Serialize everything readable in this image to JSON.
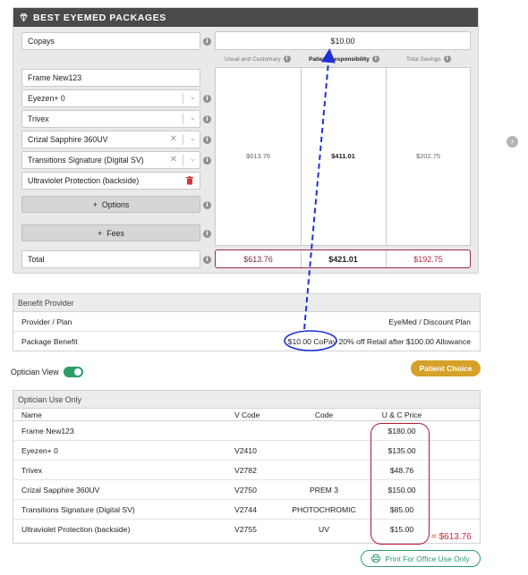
{
  "packages": {
    "title": "BEST EYEMED PACKAGES",
    "copays_label": "Copays",
    "copay_value": "$10.00",
    "columns": [
      "Usual and Customary",
      "Patient Responsibility",
      "Total Savings"
    ],
    "items": [
      {
        "label": "Frame New123",
        "kind": "text"
      },
      {
        "label": "Eyezen+ 0",
        "kind": "select"
      },
      {
        "label": "Trivex",
        "kind": "select"
      },
      {
        "label": "Crizal Sapphire 360UV",
        "kind": "select-clear"
      },
      {
        "label": "Transitions Signature (Digital SV)",
        "kind": "select-clear"
      },
      {
        "label": "Ultraviolet Protection (backside)",
        "kind": "removable"
      }
    ],
    "options_label": "Options",
    "fees_label": "Fees",
    "values": {
      "usual": "$613.76",
      "patient": "$411.01",
      "savings": "$202.75"
    },
    "total_label": "Total",
    "totals": {
      "usual": "$613.76",
      "patient": "$421.01",
      "savings": "$192.75"
    },
    "accent_color": "#9b2a4a"
  },
  "benefit": {
    "title": "Benefit Provider",
    "rows": [
      {
        "label": "Provider / Plan",
        "value": "EyeMed / Discount Plan"
      },
      {
        "label": "Package Benefit",
        "copay": "$10.00 CoPay",
        "rest": "20% off Retail after $100.00 Allowance"
      }
    ]
  },
  "optician_view": {
    "label": "Optician View",
    "on": true
  },
  "patient_choice_label": "Patient Choice",
  "optician_use": {
    "title": "Optician Use Only",
    "headers": {
      "name": "Name",
      "vcode": "V Code",
      "code": "Code",
      "price": "U & C Price"
    },
    "rows": [
      {
        "name": "Frame New123",
        "vcode": "",
        "code": "",
        "price": "$180.00"
      },
      {
        "name": "Eyezen+ 0",
        "vcode": "V2410",
        "code": "",
        "price": "$135.00"
      },
      {
        "name": "Trivex",
        "vcode": "V2782",
        "code": "",
        "price": "$48.76"
      },
      {
        "name": "Crizal Sapphire 360UV",
        "vcode": "V2750",
        "code": "PREM 3",
        "price": "$150.00"
      },
      {
        "name": "Transitions Signature (Digital SV)",
        "vcode": "V2744",
        "code": "PHOTOCHROMIC",
        "price": "$85.00"
      },
      {
        "name": "Ultraviolet Protection (backside)",
        "vcode": "V2755",
        "code": "UV",
        "price": "$15.00"
      }
    ]
  },
  "sum_note": "= $613.76",
  "print_label": "Print For Office Use Only",
  "colors": {
    "green": "#2c9c6a",
    "gold": "#d6a12a",
    "annotation_blue": "#1f2fd6",
    "annotation_red": "#b11c2a"
  }
}
